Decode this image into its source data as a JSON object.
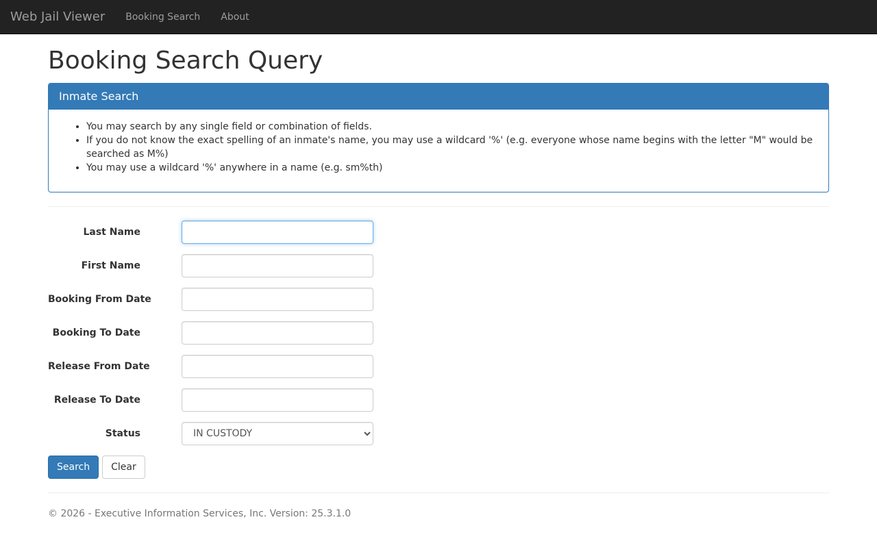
{
  "navbar": {
    "brand": "Web Jail Viewer",
    "links": [
      "Booking Search",
      "About"
    ]
  },
  "page": {
    "title": "Booking Search Query"
  },
  "panel": {
    "heading": "Inmate Search",
    "bullets": [
      "You may search by any single field or combination of fields.",
      "If you do not know the exact spelling of an inmate's name, you may use a wildcard '%' (e.g. everyone whose name begins with the letter \"M\" would be searched as M%)",
      "You may use a wildcard '%' anywhere in a name (e.g. sm%th)"
    ]
  },
  "form": {
    "fields": [
      {
        "label": "Last Name",
        "value": ""
      },
      {
        "label": "First Name",
        "value": ""
      },
      {
        "label": "Booking From Date",
        "value": ""
      },
      {
        "label": "Booking To Date",
        "value": ""
      },
      {
        "label": "Release From Date",
        "value": ""
      },
      {
        "label": "Release To Date",
        "value": ""
      }
    ],
    "status_label": "Status",
    "status_value": "IN CUSTODY",
    "search_label": "Search",
    "clear_label": "Clear"
  },
  "footer": {
    "text": "© 2026 - Executive Information Services, Inc. Version: 25.3.1.0"
  },
  "colors": {
    "navbar_bg": "#222222",
    "primary": "#337ab7"
  }
}
